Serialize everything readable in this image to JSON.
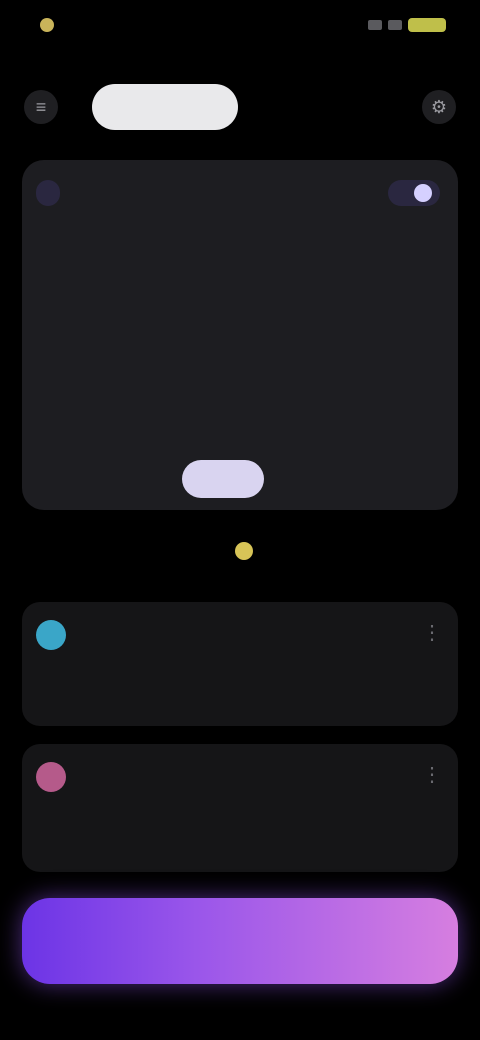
{
  "status_bar": {
    "time": "",
    "battery": ""
  },
  "top_bar": {
    "left_icon": "menu-icon",
    "right_icon": "settings-icon",
    "tabs": [
      {
        "label": "",
        "active": true
      },
      {
        "label": "",
        "active": false
      }
    ]
  },
  "feature_card": {
    "tag_left": "",
    "tag_right": "",
    "body": "",
    "meta_left": "",
    "meta_right": "",
    "prompt": "",
    "cta_label": ""
  },
  "section": {
    "title": "",
    "icon": "sparkle-icon"
  },
  "items": [
    {
      "title": "",
      "text": "",
      "avatar_color": "#3aa6c8",
      "icon": "more-icon"
    },
    {
      "title": "",
      "text": "",
      "avatar_color": "#b55a8a",
      "icon": "more-icon"
    }
  ],
  "bottom_button": {
    "label": ""
  },
  "colors": {
    "accent_start": "#6c34e6",
    "accent_end": "#d67ee0",
    "alert": "#b5384f"
  }
}
